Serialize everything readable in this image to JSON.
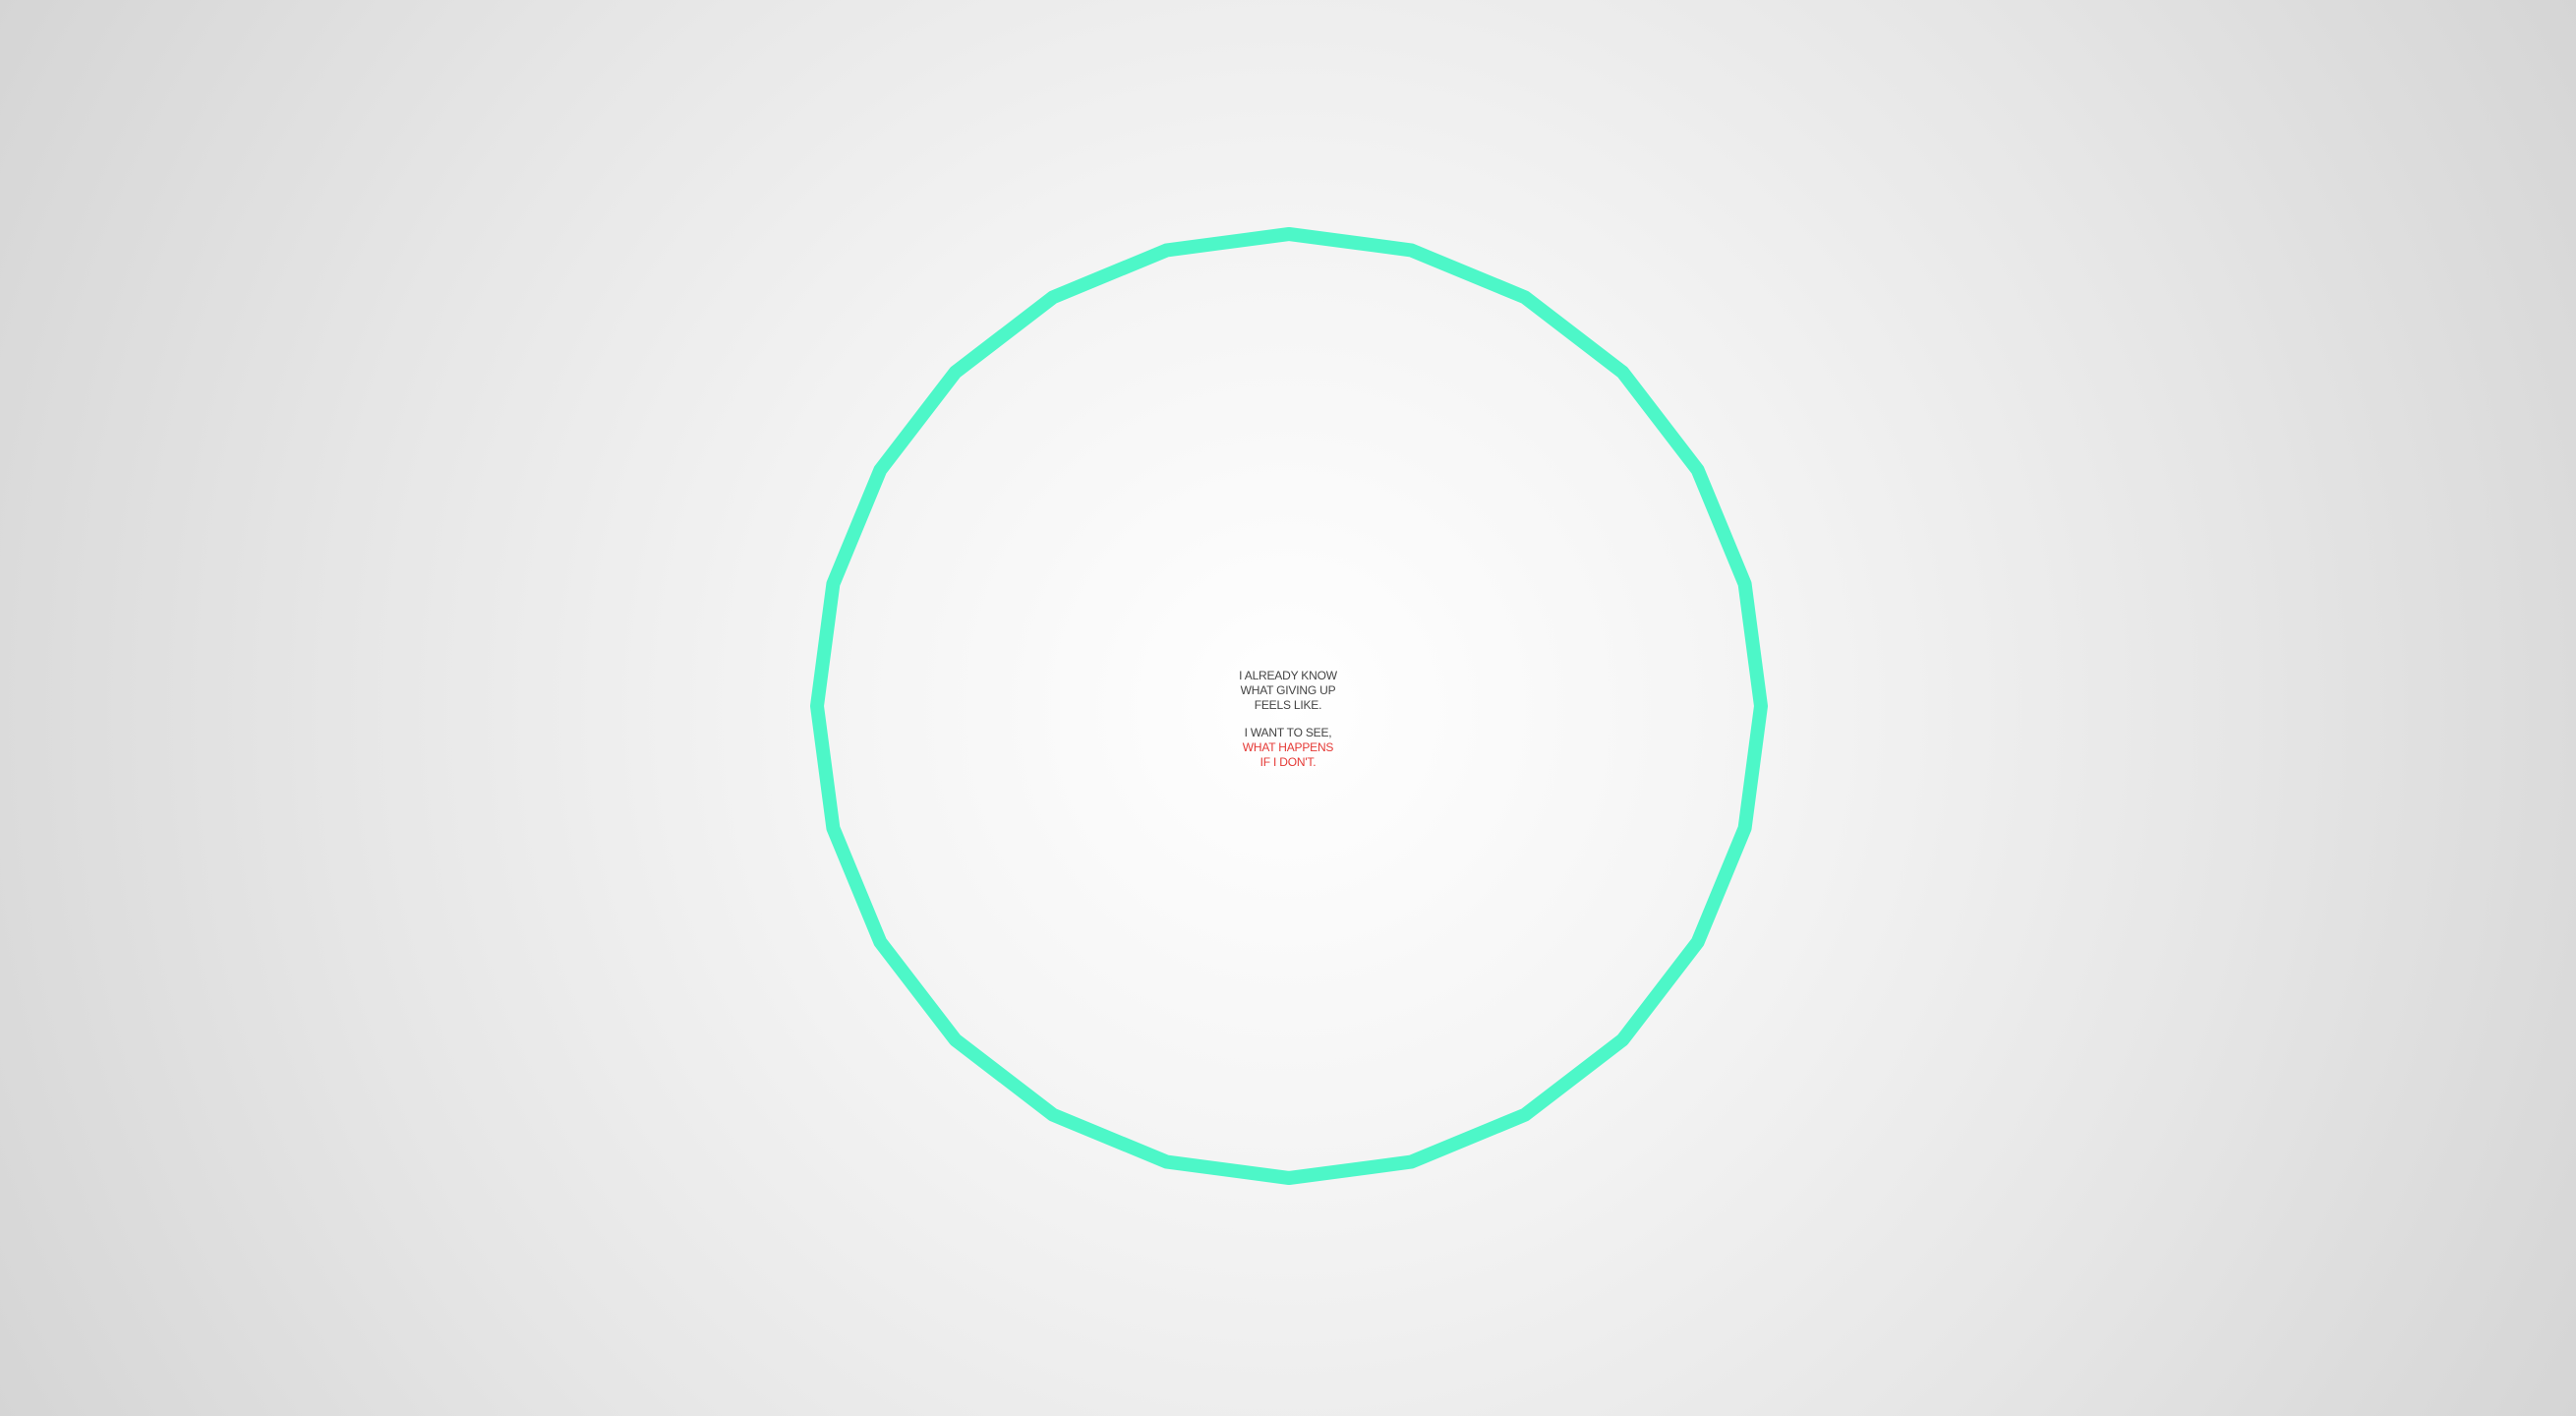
{
  "scene": {
    "ring": {
      "sides": 24,
      "stroke_color": "#4df7c8"
    },
    "message": {
      "lines_top": [
        "I ALREADY KNOW",
        "WHAT GIVING UP",
        "FEELS LIKE."
      ],
      "line_mid": "I WANT TO SEE,",
      "lines_accent": [
        "WHAT HAPPENS",
        "IF I DON'T."
      ],
      "text_color": "#444444",
      "accent_color": "#e53935"
    }
  }
}
